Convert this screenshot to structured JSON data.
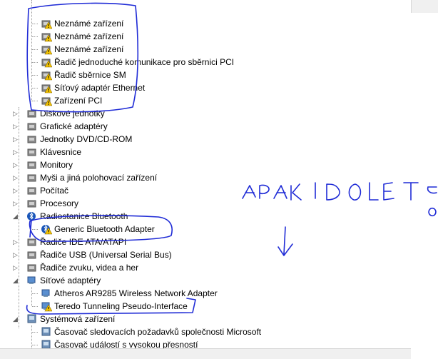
{
  "tree": {
    "unknown_devices": [
      {
        "label": "Neznámé zařízení",
        "icon": "warning-device-icon"
      },
      {
        "label": "Neznámé zařízení",
        "icon": "warning-device-icon"
      },
      {
        "label": "Neznámé zařízení",
        "icon": "warning-device-icon"
      },
      {
        "label": "Řadič jednoduché komunikace pro sběrnici PCI",
        "icon": "warning-device-icon"
      },
      {
        "label": "Řadič sběrnice SM",
        "icon": "warning-device-icon"
      },
      {
        "label": "Síťový adaptér Ethernet",
        "icon": "warning-device-icon"
      },
      {
        "label": "Zařízení PCI",
        "icon": "warning-device-icon"
      }
    ],
    "categories": [
      {
        "label": "Diskové jednotky",
        "icon": "disk-drive-icon"
      },
      {
        "label": "Grafické adaptéry",
        "icon": "display-adapter-icon"
      },
      {
        "label": "Jednotky DVD/CD-ROM",
        "icon": "dvd-drive-icon"
      },
      {
        "label": "Klávesnice",
        "icon": "keyboard-icon"
      },
      {
        "label": "Monitory",
        "icon": "monitor-icon"
      },
      {
        "label": "Myši a jiná polohovací zařízení",
        "icon": "mouse-icon"
      },
      {
        "label": "Počítač",
        "icon": "computer-icon"
      },
      {
        "label": "Procesory",
        "icon": "processor-icon"
      }
    ],
    "bluetooth": {
      "label": "Radiostanice Bluetooth",
      "icon": "bluetooth-icon",
      "child": {
        "label": "Generic Bluetooth Adapter",
        "icon": "warning-bluetooth-icon"
      }
    },
    "categories2": [
      {
        "label": "Řadiče IDE ATA/ATAPI",
        "icon": "ide-controller-icon"
      },
      {
        "label": "Řadiče USB (Universal Serial Bus)",
        "icon": "usb-controller-icon"
      },
      {
        "label": "Řadiče zvuku, videa a her",
        "icon": "sound-icon"
      }
    ],
    "network": {
      "label": "Síťové adaptéry",
      "icon": "network-adapter-icon",
      "children": [
        {
          "label": "Atheros AR9285 Wireless Network Adapter",
          "icon": "network-adapter-icon"
        },
        {
          "label": "Teredo Tunneling Pseudo-Interface",
          "icon": "warning-network-icon"
        }
      ]
    },
    "system": {
      "label": "Systémová zařízení",
      "icon": "system-device-icon",
      "children": [
        {
          "label": "Časovač sledovacích požadavků společnosti Microsoft",
          "icon": "system-device-icon"
        },
        {
          "label": "Časovač událostí s vysokou přesností",
          "icon": "system-device-icon"
        }
      ]
    }
  },
  "annotation": {
    "handwritten_text": "APAK I DOLE",
    "arrow": "down-arrow",
    "ink_color": "#1f2bd6"
  }
}
